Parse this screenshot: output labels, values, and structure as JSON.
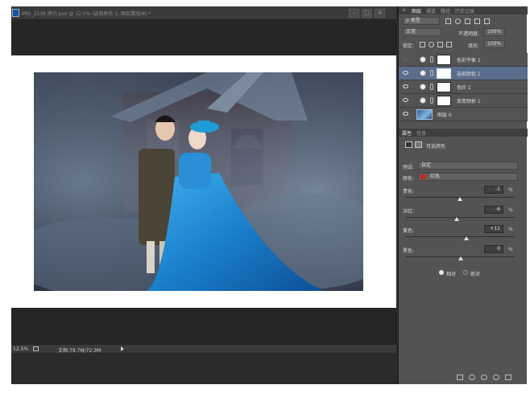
{
  "document": {
    "title": "IMG_2536 拷贝.psd @ 12.5% (选取颜色 1, 图层蒙版/8) *",
    "zoom": "12.5%",
    "doc_size": "文档:79.7M/72.3M"
  },
  "layer_panel": {
    "tabs": [
      "图层",
      "通道",
      "路径",
      "历史记录"
    ],
    "active_tab": "图层",
    "filter_label": "ρ 类型",
    "blend_mode": "正常",
    "opacity_label": "不透明度:",
    "opacity_value": "100%",
    "lock_label": "锁定:",
    "fill_label": "填充:",
    "fill_value": "100%",
    "layers": [
      {
        "name": "色彩平衡 1",
        "visible": false,
        "selected": false,
        "kind": "adjustment"
      },
      {
        "name": "选取颜色 1",
        "visible": true,
        "selected": true,
        "kind": "adjustment"
      },
      {
        "name": "色阶 1",
        "visible": true,
        "selected": false,
        "kind": "adjustment"
      },
      {
        "name": "渐变映射 1",
        "visible": true,
        "selected": false,
        "kind": "adjustment"
      },
      {
        "name": "图层 0",
        "visible": true,
        "selected": false,
        "kind": "image"
      }
    ]
  },
  "properties_panel": {
    "tabs": [
      "属性",
      "信息"
    ],
    "active_tab": "属性",
    "title": "可选颜色",
    "preset_label": "预设:",
    "preset_value": "自定",
    "colors_label": "颜色:",
    "colors_value": "红色",
    "red_swatch": "#c8281e",
    "sliders": [
      {
        "label": "青色:",
        "value": "-1",
        "pct": "%",
        "level": 0.495
      },
      {
        "label": "洋红:",
        "value": "-6",
        "pct": "%",
        "level": 0.47
      },
      {
        "label": "黄色:",
        "value": "+11",
        "pct": "%",
        "level": 0.555
      },
      {
        "label": "黑色:",
        "value": "0",
        "pct": "%",
        "level": 0.5
      }
    ],
    "mode_relative": "相对",
    "mode_absolute": "绝对",
    "selected_mode": "相对"
  },
  "colors": {
    "selected_layer": "#5b6d8c",
    "panel_bg": "#535353",
    "workspace": "#262626"
  }
}
